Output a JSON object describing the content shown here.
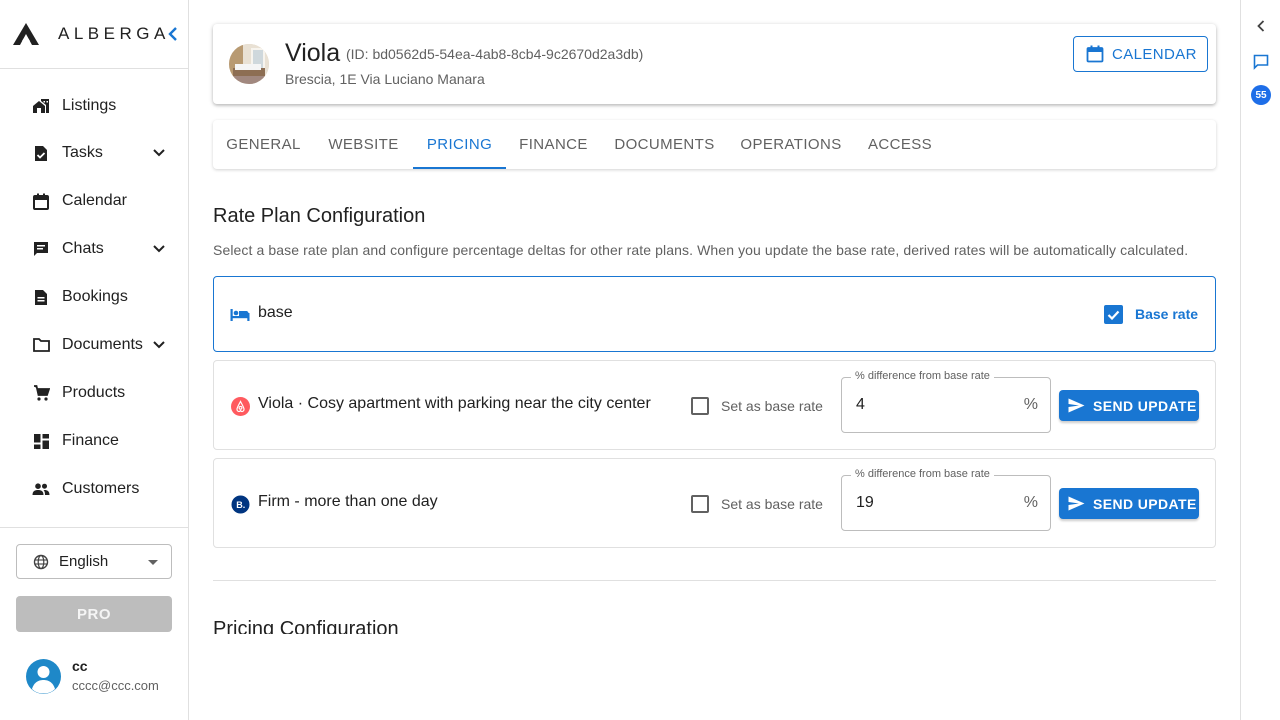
{
  "brand": {
    "name": "ALBERGA"
  },
  "sidebar": {
    "items": [
      {
        "label": "Listings",
        "icon": "home-work-icon",
        "expandable": false
      },
      {
        "label": "Tasks",
        "icon": "task-icon",
        "expandable": true
      },
      {
        "label": "Calendar",
        "icon": "calendar-icon",
        "expandable": false
      },
      {
        "label": "Chats",
        "icon": "chat-icon",
        "expandable": true
      },
      {
        "label": "Bookings",
        "icon": "document-icon",
        "expandable": false
      },
      {
        "label": "Documents",
        "icon": "folder-icon",
        "expandable": true
      },
      {
        "label": "Products",
        "icon": "cart-icon",
        "expandable": false
      },
      {
        "label": "Finance",
        "icon": "dashboard-icon",
        "expandable": false
      },
      {
        "label": "Customers",
        "icon": "people-icon",
        "expandable": false
      }
    ],
    "language": "English",
    "pro_label": "PRO",
    "user": {
      "name": "cc",
      "email": "cccc@ccc.com"
    }
  },
  "rail": {
    "badge_count": "55"
  },
  "property": {
    "name": "Viola",
    "id_text": "(ID: bd0562d5-54ea-4ab8-8cb4-9c2670d2a3db)",
    "address": "Brescia, 1E Via Luciano Manara",
    "calendar_label": "CALENDAR"
  },
  "tabs": [
    {
      "label": "GENERAL",
      "active": false
    },
    {
      "label": "WEBSITE",
      "active": false
    },
    {
      "label": "PRICING",
      "active": true
    },
    {
      "label": "FINANCE",
      "active": false
    },
    {
      "label": "DOCUMENTS",
      "active": false
    },
    {
      "label": "OPERATIONS",
      "active": false
    },
    {
      "label": "ACCESS",
      "active": false
    }
  ],
  "rate_plan": {
    "title": "Rate Plan Configuration",
    "description": "Select a base rate plan and configure percentage deltas for other rate plans. When you update the base rate, derived rates will be automatically calculated.",
    "base": {
      "name": "base",
      "base_label": "Base rate",
      "checked": true
    },
    "plans": [
      {
        "name": "Viola · Cosy apartment with parking near the city center",
        "channel_icon": "airbnb-icon",
        "set_base_label": "Set as base rate",
        "checked": false,
        "field_label": "% difference from base rate",
        "value": "4",
        "suffix": "%",
        "button_label": "SEND UPDATE"
      },
      {
        "name": "Firm - more than one day",
        "channel_icon": "booking-icon",
        "set_base_label": "Set as base rate",
        "checked": false,
        "field_label": "% difference from base rate",
        "value": "19",
        "suffix": "%",
        "button_label": "SEND UPDATE"
      }
    ]
  },
  "pricing": {
    "title": "Pricing Configuration"
  },
  "colors": {
    "primary": "#1976d2",
    "airbnb": "#ff5a5f",
    "booking": "#003580",
    "avatar": "#1e88c8"
  }
}
